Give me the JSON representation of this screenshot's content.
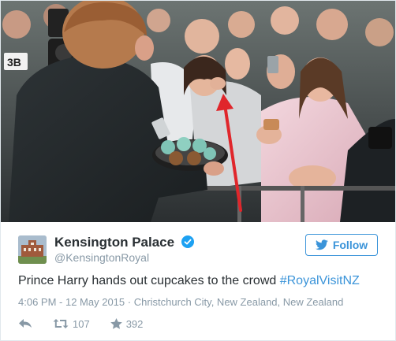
{
  "tweet": {
    "account": {
      "display_name": "Kensington Palace",
      "handle": "@KensingtonRoyal",
      "verified": true
    },
    "follow_label": "Follow",
    "text_plain": "Prince Harry hands out cupcakes to the crowd ",
    "hashtag": "#RoyalVisitNZ",
    "timestamp": "4:06 PM - 12 May 2015",
    "location_separator": " · ",
    "location": "Christchurch City, New Zealand, New Zealand",
    "retweet_count": "107",
    "favorite_count": "392"
  },
  "photo": {
    "overlay_arrow_color": "#e0262b",
    "sign_fragment": "3B"
  },
  "colors": {
    "link": "#3b94d9",
    "text": "#292f33",
    "muted": "#8899a6",
    "border": "#e1e8ed"
  },
  "icons": {
    "reply": "reply-icon",
    "retweet": "retweet-icon",
    "favorite": "star-icon",
    "verified": "verified-badge-icon",
    "follow": "twitter-bird-icon"
  }
}
